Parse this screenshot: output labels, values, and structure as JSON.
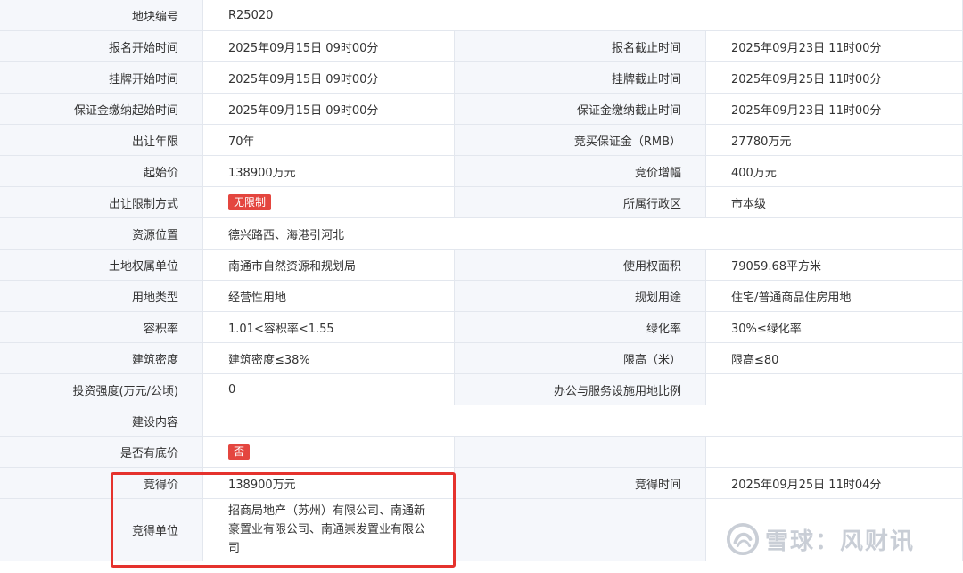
{
  "rows": [
    {
      "label": "地块编号",
      "value": "R25020"
    },
    {
      "label1": "报名开始时间",
      "value1": "2025年09月15日 09时00分",
      "label2": "报名截止时间",
      "value2": "2025年09月23日 11时00分"
    },
    {
      "label1": "挂牌开始时间",
      "value1": "2025年09月15日 09时00分",
      "label2": "挂牌截止时间",
      "value2": "2025年09月25日 11时00分"
    },
    {
      "label1": "保证金缴纳起始时间",
      "value1": "2025年09月15日 09时00分",
      "label2": "保证金缴纳截止时间",
      "value2": "2025年09月23日 11时00分"
    },
    {
      "label1": "出让年限",
      "value1": "70年",
      "label2": "竞买保证金（RMB）",
      "value2": "27780万元"
    },
    {
      "label1": "起始价",
      "value1": "138900万元",
      "label2": "竞价增幅",
      "value2": "400万元"
    },
    {
      "label1": "出让限制方式",
      "tag1": "无限制",
      "label2": "所属行政区",
      "value2": "市本级"
    },
    {
      "label": "资源位置",
      "value": "德兴路西、海港引河北"
    },
    {
      "label1": "土地权属单位",
      "value1": "南通市自然资源和规划局",
      "label2": "使用权面积",
      "value2": "79059.68平方米"
    },
    {
      "label1": "用地类型",
      "value1": "经营性用地",
      "label2": "规划用途",
      "value2": "住宅/普通商品住房用地"
    },
    {
      "label1": "容积率",
      "value1": "1.01<容积率<1.55",
      "label2": "绿化率",
      "value2": "30%≤绿化率"
    },
    {
      "label1": "建筑密度",
      "value1": "建筑密度≤38%",
      "label2": "限高（米）",
      "value2": "限高≤80"
    },
    {
      "label1": "投资强度(万元/公顷)",
      "value1": "0",
      "label2": "办公与服务设施用地比例",
      "value2": ""
    },
    {
      "label": "建设内容",
      "value": ""
    },
    {
      "label1": "是否有底价",
      "tag1": "否",
      "label2": "",
      "value2": ""
    },
    {
      "label1": "竞得价",
      "value1": "138900万元",
      "label2": "竞得时间",
      "value2": "2025年09月25日 11时04分"
    },
    {
      "label1": "竞得单位",
      "value1": "招商局地产（苏州）有限公司、南通新豪置业有限公司、南通崇发置业有限公司"
    }
  ],
  "watermark": {
    "text": "雪球：风财讯",
    "icon": "snowball-logo-icon"
  },
  "colors": {
    "label_bg": "#f5f7fb",
    "border": "#e3e7ee",
    "tag_red": "#e4463f",
    "highlight": "#e5322d"
  }
}
